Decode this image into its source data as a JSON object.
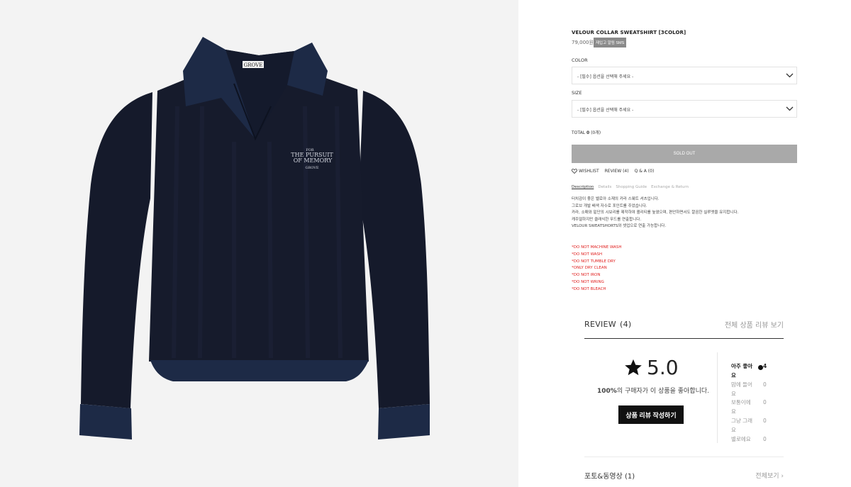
{
  "product": {
    "title": "VELOUR COLLAR SWEATSHIRT [3COLOR]",
    "price": "79,000원",
    "sms_button": "재입고 알림 SMS",
    "brand_tag": "GROVE",
    "embroidery": [
      "FOR",
      "THE PURSUIT",
      "OF MEMORY",
      "GROVE"
    ]
  },
  "options": {
    "color_label": "COLOR",
    "color_value": "- [필수] 옵션을 선택해 주세요 -",
    "size_label": "SIZE",
    "size_value": "- [필수] 옵션을 선택해 주세요 -"
  },
  "total": {
    "label": "TOTAL",
    "amount": "0",
    "count": "(0개)"
  },
  "soldout_label": "SOLD OUT",
  "actions": {
    "wishlist": "WISHLIST",
    "review": "REVIEW (4)",
    "qa": "Q & A (0)"
  },
  "tabs": [
    "Description",
    "Details",
    "Shopping Guide",
    "Exchange & Return"
  ],
  "description": [
    "터치감이 좋은 벨로아 소재의 카라 스웨트 셔츠입니다.",
    "그로브 개발 배색 자수로 포인트를 주었습니다.",
    "카라, 소매와 밑단의 시보리를 제작하여 퀄리티를 높였으며, 편안하면서도 깔끔한 실루엣을 유지합니다.",
    "캐주얼하지만 클래식한 무드를 연출합니다.",
    "VELOUR SWEATSHORTS와 셋업으로 연출 가능합니다."
  ],
  "care": [
    "*DO NOT MACHINE WASH",
    "*DO NOT WASH",
    "*DO NOT TUMBLE DRY",
    "*ONLY DRY CLEAN",
    "*DO NOT IRON",
    "*DO NOT WRING",
    "*DO NOT BLEACH"
  ],
  "review": {
    "title": "REVIEW",
    "count": "(4)",
    "view_all": "전체 상품 리뷰 보기",
    "score": "5.0",
    "percent": "100%",
    "percent_text": "의 구매자가 이 상품을 좋아합니다.",
    "write_button": "상품 리뷰 작성하기",
    "distribution": [
      {
        "label": "아주 좋아요",
        "count": "4"
      },
      {
        "label": "맘에 들어요",
        "count": "0"
      },
      {
        "label": "보통이에요",
        "count": "0"
      },
      {
        "label": "그냥 그래요",
        "count": "0"
      },
      {
        "label": "별로에요",
        "count": "0"
      }
    ],
    "media_title": "포토&동영상 (1)",
    "media_all": "전체보기 ›"
  },
  "colors": {
    "sweatshirt": "#161b2c",
    "rib": "#1d2a46",
    "soldout": "#a9a9a9",
    "care_text": "#e1201f"
  }
}
